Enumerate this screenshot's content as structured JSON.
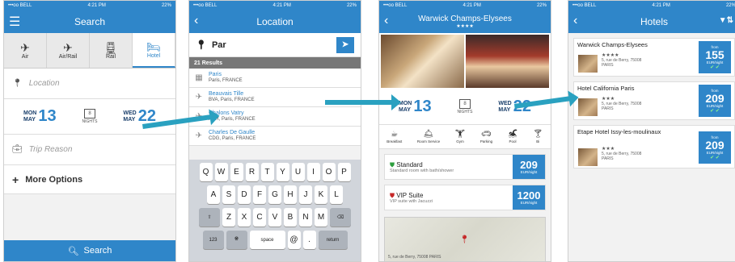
{
  "status": {
    "carrier": "•••oo BELL",
    "time": "4:21 PM",
    "battery": "22%"
  },
  "screen1": {
    "title": "Search",
    "tabs": [
      {
        "label": "Air",
        "icon": "plane-icon"
      },
      {
        "label": "Air/Rail",
        "icon": "plane-rail-icon"
      },
      {
        "label": "Rail",
        "icon": "train-icon"
      },
      {
        "label": "Hotel",
        "icon": "hotel-icon"
      }
    ],
    "location_placeholder": "Location",
    "checkin": {
      "day": "MON",
      "month": "MAY",
      "num": "13"
    },
    "nights": {
      "count": "8",
      "label": "NIGHTS"
    },
    "checkout": {
      "day": "WED",
      "month": "MAY",
      "num": "22"
    },
    "trip_reason_placeholder": "Trip Reason",
    "more_options": "More Options",
    "search_button": "Search"
  },
  "screen2": {
    "title": "Location",
    "query": "Par",
    "results_count": "21 Results",
    "results": [
      {
        "name": "Paris",
        "sub": "Paris, FRANCE",
        "icon": "city-icon"
      },
      {
        "name": "Beauvais Tille",
        "sub": "BVA, Paris, FRANCE",
        "icon": "plane-icon"
      },
      {
        "name": "Chalons Vatry",
        "sub": "XCR, Paris, FRANCE",
        "icon": "plane-icon"
      },
      {
        "name": "Charles De Gaulle",
        "sub": "CDG, Paris, FRANCE",
        "icon": "plane-icon"
      }
    ],
    "keyboard": {
      "row1": [
        "Q",
        "W",
        "E",
        "R",
        "T",
        "Y",
        "U",
        "I",
        "O",
        "P"
      ],
      "row2": [
        "A",
        "S",
        "D",
        "F",
        "G",
        "H",
        "J",
        "K",
        "L"
      ],
      "row3": [
        "Z",
        "X",
        "C",
        "V",
        "B",
        "N",
        "M"
      ],
      "num_key": "123",
      "space_key": "space",
      "at_key": "@",
      "dot_key": ".",
      "return_key": "return"
    }
  },
  "screen3": {
    "title": "Warwick Champs-Elysees",
    "stars": "★★★★",
    "checkin": {
      "day": "MON",
      "month": "MAY",
      "num": "13"
    },
    "nights": {
      "count": "8",
      "label": "NIGHTS"
    },
    "checkout": {
      "day": "WED",
      "month": "MAY",
      "num": "22"
    },
    "amenities": [
      "Breakfast",
      "Room Service",
      "Gym",
      "Parking",
      "Pool",
      "Bi"
    ],
    "rooms": [
      {
        "name": "Standard",
        "desc": "Standard room with bath/shower",
        "price": "209",
        "unit": "EUR/night"
      },
      {
        "name": "VIP Suite",
        "desc": "VIP suite with Jacuzzi",
        "price": "1200",
        "unit": "EUR/night"
      }
    ],
    "map_address": "5, rue de Berry, 75008 PARIS"
  },
  "screen4": {
    "title": "Hotels",
    "hotels": [
      {
        "name": "Warwick Champs-Elysees",
        "stars": "★★★★",
        "addr1": "5, rue de Berry, 75008",
        "addr2": "PARIS",
        "from": "from",
        "price": "155",
        "unit": "EUR/night",
        "check": "✔ ✔"
      },
      {
        "name": "Hotel California Paris",
        "stars": "★★★",
        "addr1": "5, rue de Berry, 75008",
        "addr2": "PARIS",
        "from": "from",
        "price": "209",
        "unit": "EUR/night",
        "check": "✔ ✔"
      },
      {
        "name": "Etape Hotel Issy-les-moulinaux",
        "stars": "★★★",
        "addr1": "5, rue de Berry, 75008",
        "addr2": "PARIS",
        "from": "from",
        "price": "209",
        "unit": "EUR/night",
        "check": "✔ ✔"
      }
    ]
  }
}
